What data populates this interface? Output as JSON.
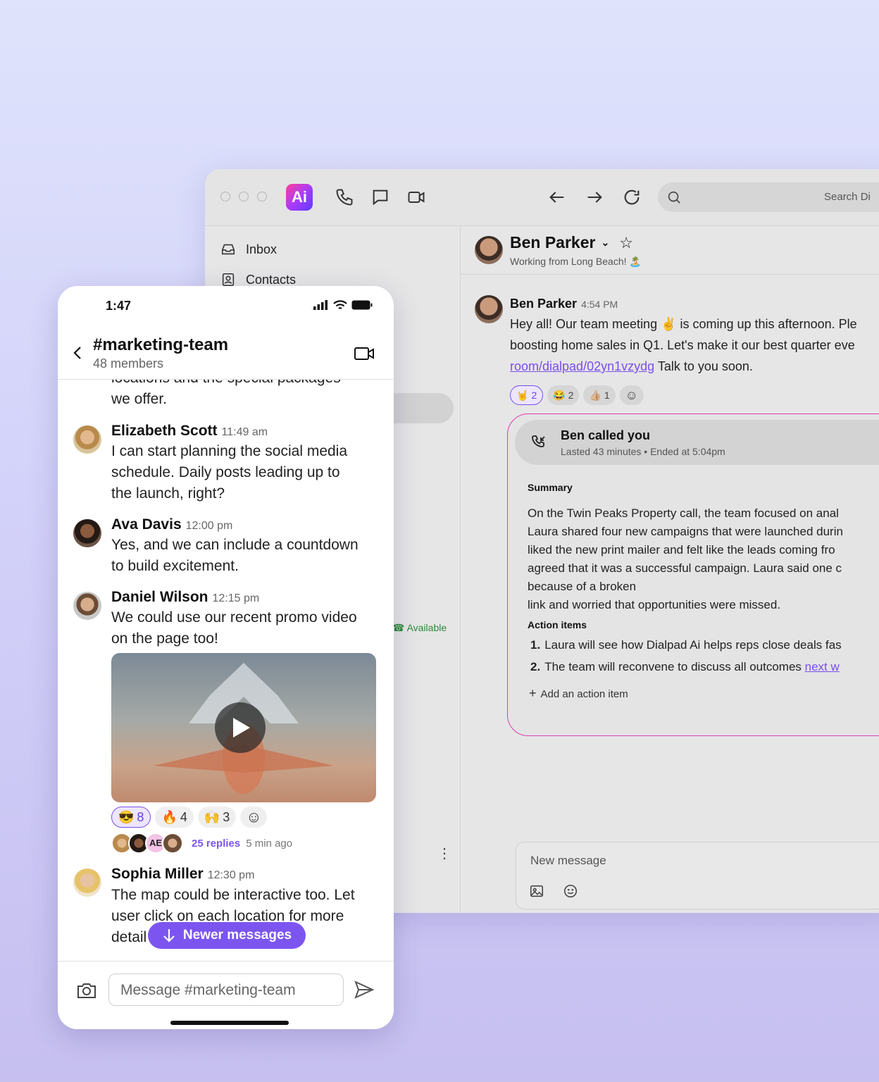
{
  "desktop": {
    "search_placeholder": "Search Di",
    "sidebar": {
      "items": [
        {
          "label": "Inbox",
          "icon": "inbox-icon"
        },
        {
          "label": "Contacts",
          "icon": "contacts-icon"
        }
      ],
      "available_label": "Available"
    },
    "header": {
      "name": "Ben Parker",
      "status": "Working from Long Beach! 🏝️"
    },
    "message": {
      "author": "Ben Parker",
      "time": "4:54 PM",
      "line1": "Hey all! Our team meeting ✌️ is coming up this afternoon. Ple",
      "line2": "boosting home sales in Q1. Let's make it our best quarter eve",
      "link": "room/dialpad/02yn1vzydg",
      "line3_tail": " Talk to you soon.",
      "reactions": [
        {
          "emoji": "🤘",
          "count": "2",
          "selected": true
        },
        {
          "emoji": "😂",
          "count": "2",
          "selected": false
        },
        {
          "emoji": "👍🏼",
          "count": "1",
          "selected": false
        }
      ]
    },
    "call": {
      "title": "Ben called you",
      "subtitle": "Lasted 43 minutes • Ended at 5:04pm",
      "summary_title": "Summary",
      "summary_lines": [
        "On the Twin Peaks Property call, the team focused on anal",
        "Laura shared four new campaigns that were launched durin",
        "liked the new print mailer and felt like the leads coming fro",
        "agreed that it was a successful campaign. Laura said one c",
        "because of a broken",
        "link and worried that opportunities were missed."
      ],
      "action_title": "Action items",
      "action_items": [
        {
          "num": "1.",
          "text": "Laura will see how Dialpad Ai helps reps close deals fas"
        },
        {
          "num": "2.",
          "text": "The team will reconvene to discuss all outcomes ",
          "link": "next w"
        }
      ],
      "add_action": "Add an action item"
    },
    "composer_placeholder": "New message"
  },
  "phone": {
    "time": "1:47",
    "channel": "#marketing-team",
    "members": "48 members",
    "partial_text": "locations and the special packages\nwe offer.",
    "messages": [
      {
        "name": "Elizabeth Scott",
        "time": "11:49 am",
        "text": "I can start planning the social media\nschedule. Daily posts leading up to\nthe launch, right?"
      },
      {
        "name": "Ava Davis",
        "time": "12:00 pm",
        "text": "Yes, and we can include a countdown\nto build excitement."
      },
      {
        "name": "Daniel Wilson",
        "time": "12:15 pm",
        "text": "We could use our recent promo video\non the page too!"
      },
      {
        "name": "Sophia Miller",
        "time": "12:30 pm",
        "text": "The map could be interactive too. Let\nuser click on each location for more\ndetail"
      }
    ],
    "reactions": [
      {
        "emoji": "😎",
        "count": "8",
        "selected": true
      },
      {
        "emoji": "🔥",
        "count": "4",
        "selected": false
      },
      {
        "emoji": "🙌",
        "count": "3",
        "selected": false
      }
    ],
    "reply_initials": "AE",
    "replies_label": "25 replies",
    "replies_time": "5 min ago",
    "newer_label": "Newer messages",
    "input_placeholder": "Message #marketing-team"
  },
  "colors": {
    "accent": "#7c55f0",
    "call_border": "#e03cb0",
    "available": "#2e8a3a"
  }
}
